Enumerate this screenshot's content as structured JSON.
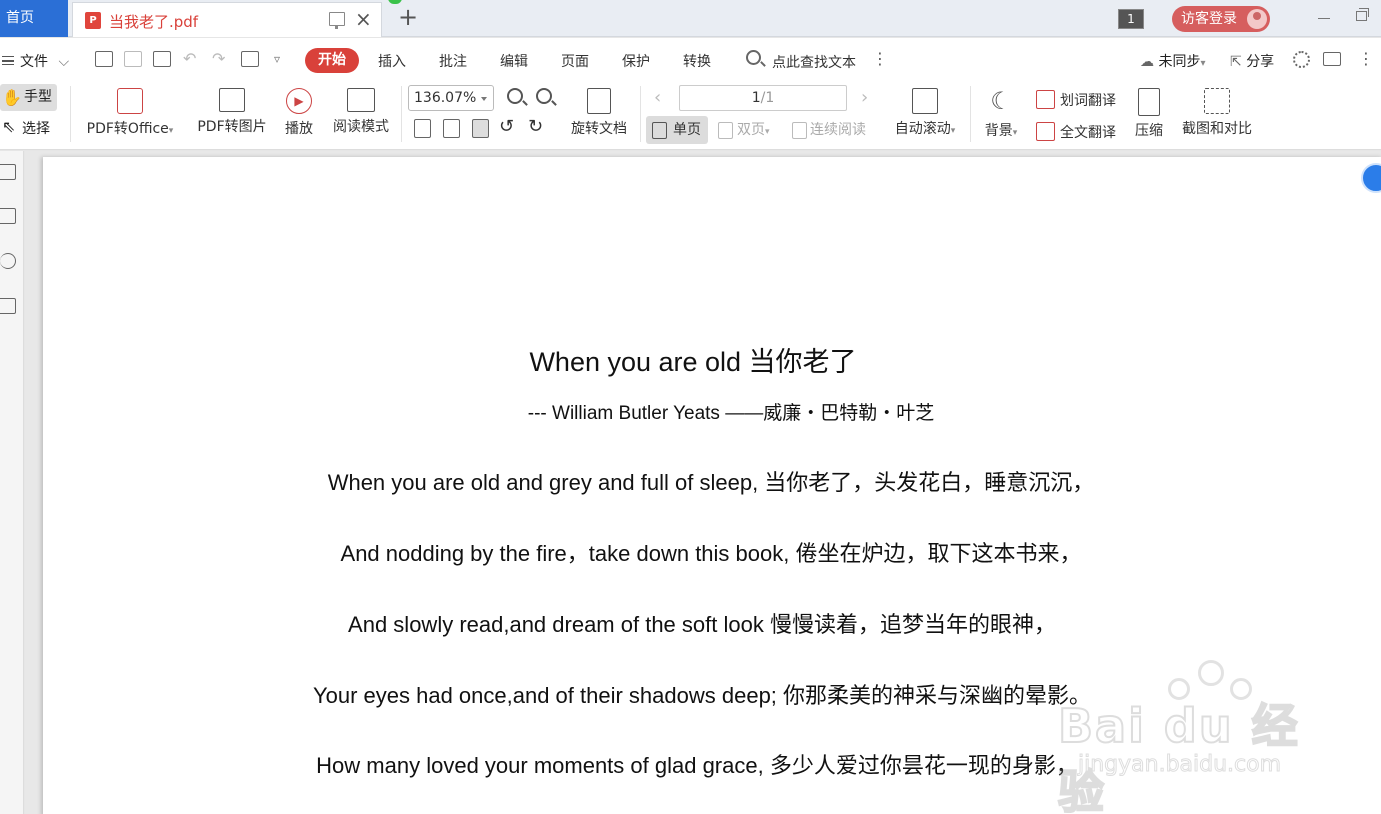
{
  "tabs": {
    "home": "首页",
    "doc_title": "当我老了.pdf",
    "window_count": "1",
    "login": "访客登录"
  },
  "menu": {
    "file": "文件",
    "items": [
      "开始",
      "插入",
      "批注",
      "编辑",
      "页面",
      "保护",
      "转换"
    ],
    "search_placeholder": "点此查找文本",
    "sync": "未同步",
    "share": "分享"
  },
  "ribbon": {
    "hand": "手型",
    "select": "选择",
    "pdf_to_office": "PDF转Office",
    "pdf_to_image": "PDF转图片",
    "play": "播放",
    "read_mode": "阅读模式",
    "zoom": "136.07%",
    "rotate_doc": "旋转文档",
    "page_current": "1",
    "page_total": "/1",
    "single": "单页",
    "double": "双页",
    "continuous": "连续阅读",
    "auto_scroll": "自动滚动",
    "background": "背景",
    "word_translate": "划词翻译",
    "full_translate": "全文翻译",
    "compress": "压缩",
    "screenshot_compare": "截图和对比"
  },
  "document": {
    "title": "When you are old  当你老了",
    "author": "--- William Butler Yeats  ——威廉・巴特勒・叶芝",
    "lines": [
      "When you are old and grey and full of sleep,  当你老了，头发花白，睡意沉沉，",
      "And nodding by the fire，take down this book,  倦坐在炉边，取下这本书来，",
      "And slowly read,and dream of the soft look  慢慢读着，追梦当年的眼神，",
      "Your eyes had once,and of their shadows deep;  你那柔美的神采与深幽的晕影。",
      "How many loved your moments of glad grace,  多少人爱过你昙花一现的身影，"
    ]
  },
  "watermark": {
    "text": "Bai du 经验",
    "url": "jingyan.baidu.com"
  },
  "colors": {
    "accent_red": "#d9413a",
    "home_tab_blue": "#2b6fd6"
  }
}
